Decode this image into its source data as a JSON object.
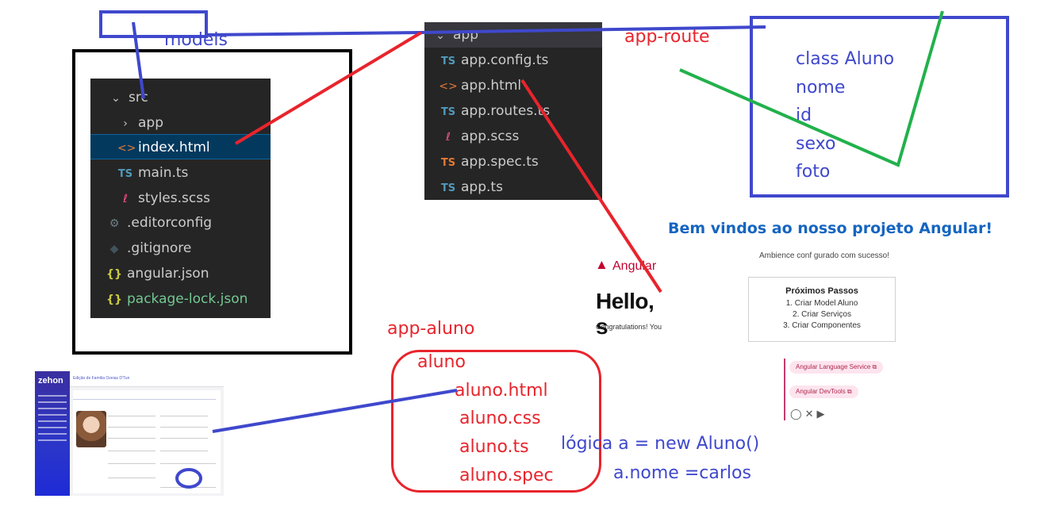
{
  "labels": {
    "models": "models",
    "app_route": "app-route",
    "app_aluno": "app-aluno",
    "logic_line1": "lógica  a = new Aluno()",
    "logic_line2": "a.nome =carlos"
  },
  "src_tree": {
    "rows": [
      {
        "icon": "chevron-down-icon",
        "glyph": "⌄",
        "label": "src"
      },
      {
        "icon": "chevron-right-icon",
        "glyph": "›",
        "label": "app"
      },
      {
        "icon": "html-file-icon",
        "glyph": "<>",
        "label": "index.html"
      },
      {
        "icon": "typescript-file-icon",
        "glyph": "TS",
        "label": "main.ts"
      },
      {
        "icon": "scss-file-icon",
        "glyph": "ℓ",
        "label": "styles.scss"
      },
      {
        "icon": "gear-icon",
        "glyph": "⚙",
        "label": ".editorconfig"
      },
      {
        "icon": "git-icon",
        "glyph": "◆",
        "label": ".gitignore"
      },
      {
        "icon": "json-file-icon",
        "glyph": "{}",
        "label": "angular.json"
      },
      {
        "icon": "json-file-icon",
        "glyph": "{}",
        "label": "package-lock.json"
      }
    ]
  },
  "app_folder": {
    "header": "app",
    "files": [
      {
        "icon": "typescript-file-icon",
        "glyph": "TS",
        "label": "app.config.ts"
      },
      {
        "icon": "html-file-icon",
        "glyph": "<>",
        "label": "app.html"
      },
      {
        "icon": "typescript-file-icon",
        "glyph": "TS",
        "label": "app.routes.ts"
      },
      {
        "icon": "scss-file-icon",
        "glyph": "ℓ",
        "label": "app.scss"
      },
      {
        "icon": "typescript-file-icon",
        "glyph": "TS",
        "label": "app.spec.ts"
      },
      {
        "icon": "typescript-file-icon",
        "glyph": "TS",
        "label": "app.ts"
      }
    ]
  },
  "class_box": {
    "lines": [
      "class Aluno",
      "nome",
      "id",
      "sexo",
      "foto"
    ]
  },
  "aluno_box": {
    "folder": "aluno",
    "files": [
      "aluno.html",
      "aluno.css",
      "aluno.ts",
      "aluno.spec"
    ]
  },
  "welcome": {
    "title": "Bem vindos ao nosso projeto Angular!",
    "subtitle": "Ambience conf gurado com sucesso!",
    "steps_title": "Próximos Passos",
    "steps": [
      "1. Criar Model Aluno",
      "2. Criar Serviços",
      "3. Criar Componentes"
    ],
    "pill1": "Angular Language Service ⧉",
    "pill2": "Angular DevTools ⧉"
  },
  "hello_card": {
    "brand": "Angular",
    "heading": "Hello, s",
    "text": "Congratulations! Your"
  },
  "zehon": {
    "brand": "zehon",
    "crumb": "Edição de Família Ozeias D'Tun"
  },
  "colors": {
    "red": "#e8242c",
    "blue": "#3f48cc",
    "green": "#22b14c",
    "vscode_bg": "#252526"
  }
}
